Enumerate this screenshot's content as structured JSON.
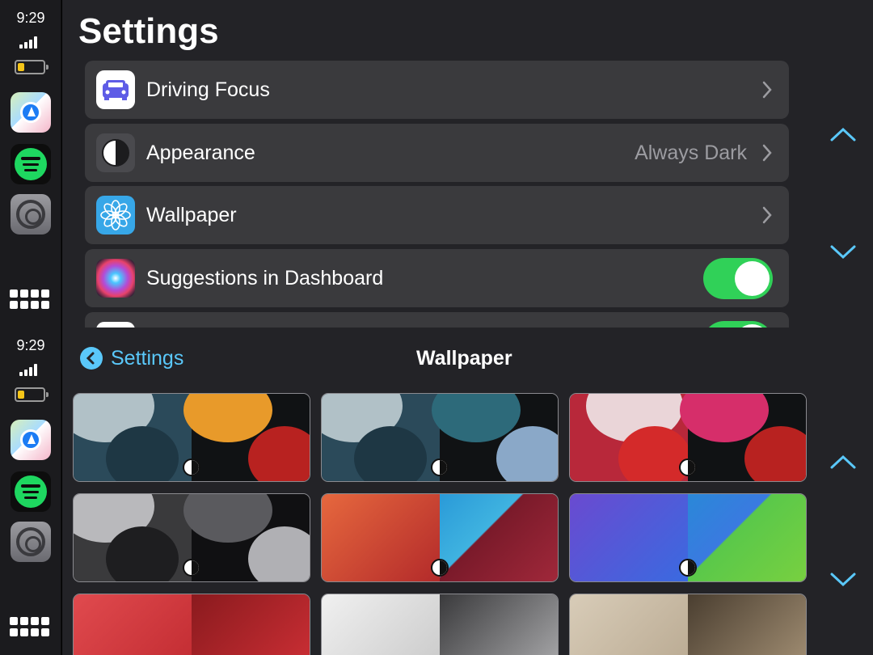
{
  "status": {
    "time": "9:29"
  },
  "dock": {
    "apps": [
      {
        "name": "Maps",
        "icon": "maps-icon"
      },
      {
        "name": "Spotify",
        "icon": "spotify-icon"
      },
      {
        "name": "Settings",
        "icon": "settings-icon"
      }
    ],
    "home_icon": "app-grid-icon"
  },
  "settings_screen": {
    "title": "Settings",
    "rows": [
      {
        "label": "Driving Focus",
        "icon": "car-icon",
        "accessory": "chevron"
      },
      {
        "label": "Appearance",
        "value": "Always Dark",
        "icon": "appearance-icon",
        "accessory": "chevron"
      },
      {
        "label": "Wallpaper",
        "icon": "flower-icon",
        "accessory": "chevron"
      },
      {
        "label": "Suggestions in Dashboard",
        "icon": "siri-icon",
        "accessory": "toggle",
        "on": true
      }
    ]
  },
  "wallpaper_screen": {
    "back_label": "Settings",
    "title": "Wallpaper",
    "tiles": [
      {
        "left": "#2b4a5a",
        "right": "#e89a2a",
        "mode_icon": true
      },
      {
        "left": "#2b4a5a",
        "right": "#2d6a7a",
        "mode_icon": true
      },
      {
        "left": "#b8283a",
        "right": "#d62e6a",
        "mode_icon": true
      },
      {
        "left": "#3a3a3c",
        "right": "#5a5a5e",
        "mode_icon": true
      },
      {
        "left": "#e05a3a",
        "right": "#3fb3e0",
        "mode_icon": true
      },
      {
        "left": "#4a56c8",
        "right": "#5ac84a",
        "mode_icon": true
      },
      {
        "left": "#d23a3e",
        "right": "#b8282c",
        "mode_icon": false
      },
      {
        "left": "#dcdcdc",
        "right": "#8a8a8c",
        "mode_icon": false
      },
      {
        "left": "#cdbfa8",
        "right": "#8a7a62",
        "mode_icon": false
      }
    ]
  },
  "colors": {
    "accent": "#5ac8fa",
    "toggle_on": "#30d158",
    "row_bg": "#3a3a3d",
    "panel_bg": "#232327"
  }
}
